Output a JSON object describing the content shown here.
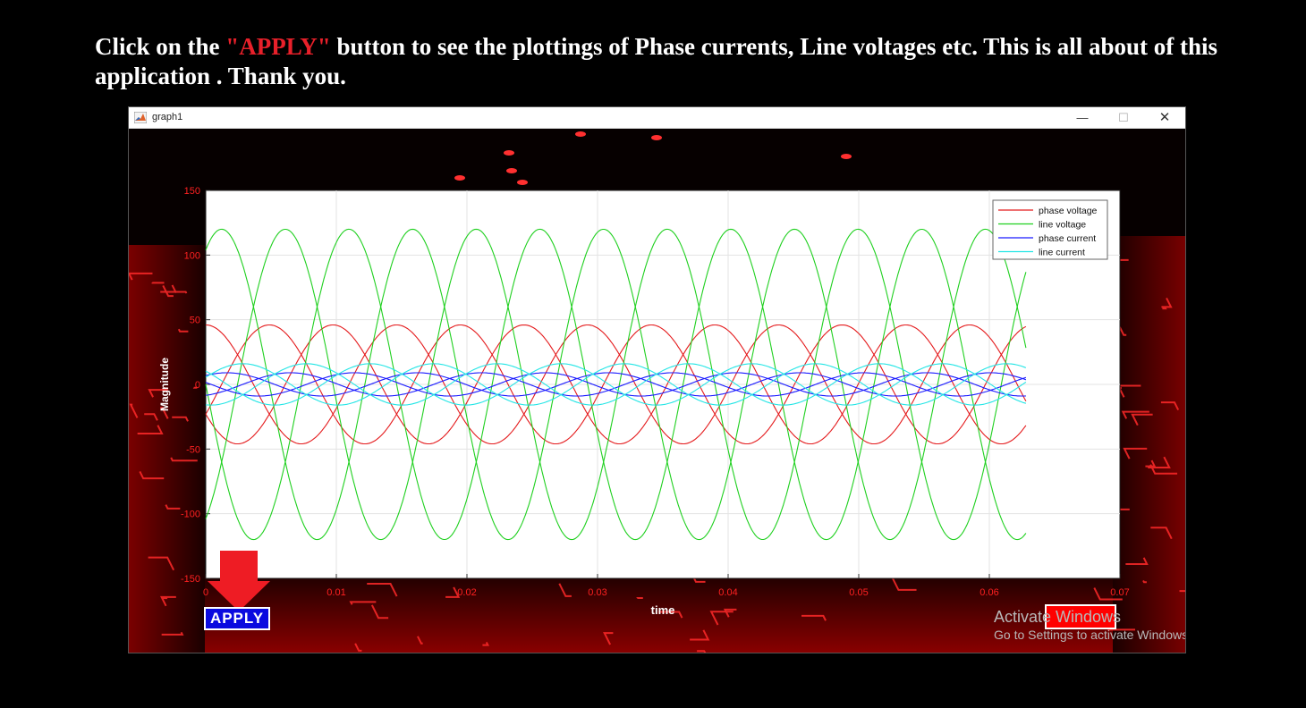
{
  "instruction": {
    "prefix": "Click on the ",
    "highlight": "\"APPLY\"",
    "suffix": " button to see the plottings of Phase currents, Line voltages etc. This is all about of this application . Thank you."
  },
  "window": {
    "title": "graph1",
    "controls": {
      "minimize": "—",
      "maximize": "☐",
      "close": "✕"
    }
  },
  "buttons": {
    "apply_label": "APPLY",
    "exit_label": ""
  },
  "watermark": {
    "title": "Activate Windows",
    "subtitle": "Go to Settings to activate Windows."
  },
  "colors": {
    "phase_voltage": "#e41a1c",
    "line_voltage": "#1fd01f",
    "phase_current": "#1a1aff",
    "line_current": "#22e5e5",
    "tick_labels": "#ff2020",
    "apply_bg": "#0a0adf",
    "accent_red": "#ff0000"
  },
  "chart_data": {
    "type": "line",
    "xlabel": "time",
    "ylabel": "Magnitude",
    "xlim": [
      0,
      0.07
    ],
    "ylim": [
      -150,
      150
    ],
    "xticks": [
      0,
      0.01,
      0.02,
      0.03,
      0.04,
      0.05,
      0.06,
      0.07
    ],
    "xtick_labels": [
      "0",
      "0.01",
      "0.02",
      "0.03",
      "0.04",
      "0.05",
      "0.06",
      "0.07"
    ],
    "yticks": [
      -150,
      -100,
      -50,
      0,
      50,
      100,
      150
    ],
    "ytick_labels": [
      "-150",
      "-100",
      "-50",
      "0",
      "50",
      "100",
      "150"
    ],
    "grid": true,
    "legend_position": "top-right",
    "x_range_plotted": [
      0,
      0.0628
    ],
    "frequency_hz": 68.4,
    "series": [
      {
        "name": "phase voltage",
        "color": "#e41a1c",
        "amplitude": 46,
        "phase_deg": [
          90,
          -30,
          210
        ]
      },
      {
        "name": "line voltage",
        "color": "#1fd01f",
        "amplitude": 120,
        "phase_deg": [
          60,
          -60,
          180
        ]
      },
      {
        "name": "phase current",
        "color": "#1a1aff",
        "amplitude": 9,
        "phase_deg": [
          50,
          -70,
          170
        ]
      },
      {
        "name": "line current",
        "color": "#22e5e5",
        "amplitude": 16,
        "phase_deg": [
          20,
          -100,
          140
        ]
      }
    ]
  }
}
